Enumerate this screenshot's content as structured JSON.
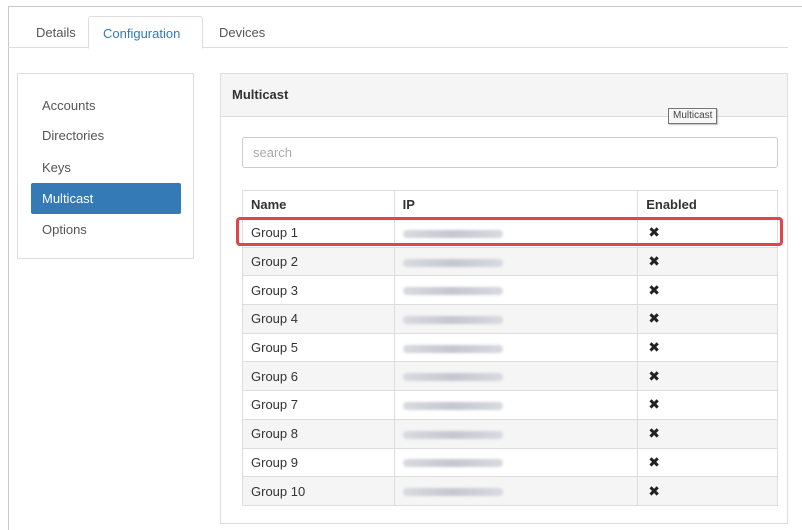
{
  "tabs": [
    {
      "label": "Details"
    },
    {
      "label": "Configuration",
      "active": true
    },
    {
      "label": "Devices"
    }
  ],
  "menu": {
    "items": [
      {
        "label": "Accounts"
      },
      {
        "label": "Directories"
      },
      {
        "label": "Keys"
      },
      {
        "label": "Multicast",
        "active": true
      },
      {
        "label": "Options"
      }
    ]
  },
  "panel": {
    "title": "Multicast",
    "tooltip": "Multicast",
    "search_placeholder": "search"
  },
  "table": {
    "columns": [
      "Name",
      "IP",
      "Enabled"
    ],
    "rows": [
      {
        "name": "Group 1",
        "enabled": "✖"
      },
      {
        "name": "Group 2",
        "enabled": "✖"
      },
      {
        "name": "Group 3",
        "enabled": "✖"
      },
      {
        "name": "Group 4",
        "enabled": "✖"
      },
      {
        "name": "Group 5",
        "enabled": "✖"
      },
      {
        "name": "Group 6",
        "enabled": "✖"
      },
      {
        "name": "Group 7",
        "enabled": "✖"
      },
      {
        "name": "Group 8",
        "enabled": "✖"
      },
      {
        "name": "Group 9",
        "enabled": "✖"
      },
      {
        "name": "Group 10",
        "enabled": "✖"
      }
    ]
  },
  "colors": {
    "accent": "#337ab7",
    "highlight": "#e0454a"
  }
}
